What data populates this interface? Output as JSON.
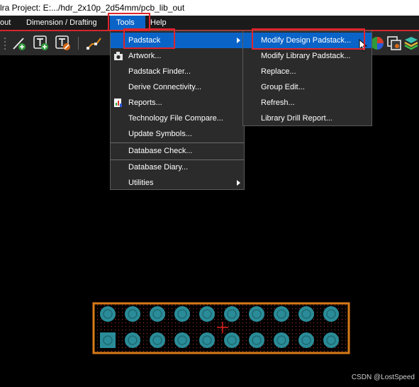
{
  "titlebar": {
    "text": "lra  Project: E:.../hdr_2x10p_2d54mm/pcb_lib_out"
  },
  "menubar": {
    "items": [
      "out",
      "Dimension / Drafting",
      "Tools",
      "Help"
    ]
  },
  "tools_menu": {
    "items": [
      "Padstack",
      "Artwork...",
      "Padstack Finder...",
      "Derive Connectivity...",
      "Reports...",
      "Technology File Compare...",
      "Update Symbols...",
      "Database Check...",
      "Database Diary...",
      "Utilities"
    ]
  },
  "padstack_submenu": {
    "items": [
      "Modify Design Padstack...",
      "Modify Library Padstack...",
      "Replace...",
      "Group Edit...",
      "Refresh...",
      "Library Drill Report..."
    ]
  },
  "colors": {
    "highlight": "#0a64c8",
    "annotation_red": "#e0242c",
    "pad_teal": "#2a8c98",
    "outline_orange": "#d87a18"
  },
  "watermark": "CSDN @LostSpeed"
}
